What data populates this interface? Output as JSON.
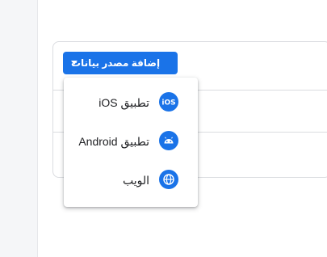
{
  "add_data_source": {
    "label": "إضافة مصدر بيانات"
  },
  "menu": {
    "items": [
      {
        "label": "تطبيق iOS",
        "icon": "ios-icon"
      },
      {
        "label": "تطبيق Android",
        "icon": "android-icon"
      },
      {
        "label": "الويب",
        "icon": "web-globe-icon"
      }
    ]
  },
  "colors": {
    "accent": "#1a73e8",
    "highlight": "#f4f005"
  }
}
